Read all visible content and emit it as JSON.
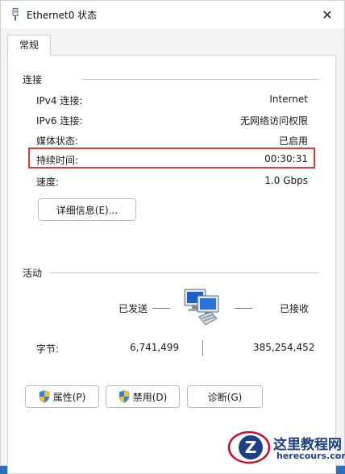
{
  "window": {
    "title": "Ethernet0 状态",
    "close_glyph": "✕"
  },
  "tabs": [
    {
      "label": "常规"
    }
  ],
  "connection": {
    "title": "连接",
    "rows": [
      {
        "label": "IPv4 连接:",
        "value": "Internet"
      },
      {
        "label": "IPv6 连接:",
        "value": "无网络访问权限"
      },
      {
        "label": "媒体状态:",
        "value": "已启用"
      },
      {
        "label": "持续时间:",
        "value": "00:30:31"
      },
      {
        "label": "速度:",
        "value": "1.0 Gbps"
      }
    ],
    "details_button": "详细信息(E)..."
  },
  "activity": {
    "title": "活动",
    "sent_label": "已发送",
    "received_label": "已接收",
    "bytes_label": "字节:",
    "bytes_sent": "6,741,499",
    "bytes_received": "385,254,452"
  },
  "buttons": {
    "properties": "属性(P)",
    "disable": "禁用(D)",
    "diagnose": "诊断(G)"
  },
  "watermark": {
    "cn": "这里教程网",
    "en": "herecours.com"
  },
  "colors": {
    "highlight": "#e03a3a",
    "accent": "#2f6fb7"
  }
}
